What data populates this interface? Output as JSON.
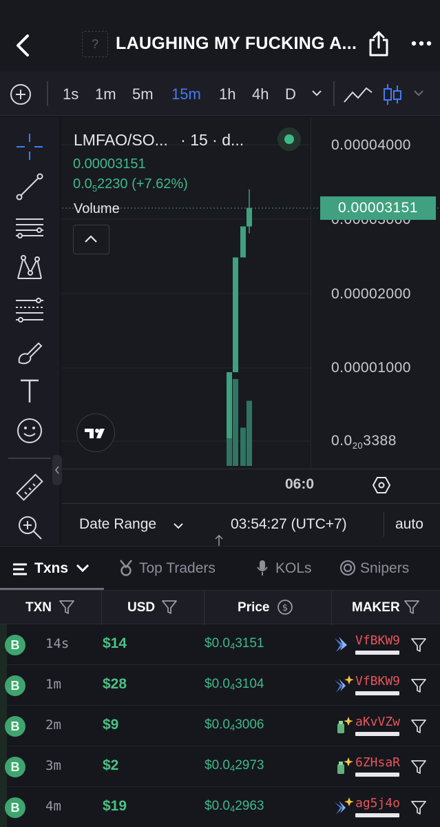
{
  "header": {
    "title": "LAUGHING MY FUCKING A...",
    "token_image_placeholder": "?"
  },
  "toolbar": {
    "timeframes": [
      "1s",
      "1m",
      "5m",
      "15m",
      "1h",
      "4h",
      "D"
    ],
    "active_timeframe": "15m"
  },
  "chart": {
    "symbol": "LMFAO/SO...",
    "interval_label": "· 15 · d...",
    "ohlc_price": "0.00003151",
    "change_prefix": "0.0",
    "change_zero_count": "5",
    "change_digits": "2230",
    "change_pct": "(+7.62%)",
    "volume_label": "Volume",
    "price_tag": "0.00003151",
    "y_ticks": {
      "t1": "0.00004000",
      "t2": "0.00003000",
      "t3": "0.00002000",
      "t4": "0.00001000",
      "t5_prefix": "0.0",
      "t5_zero_count": "20",
      "t5_digits": "3388"
    },
    "x_tick": "06:0",
    "date_range_label": "Date Range",
    "clock": "03:54:27 (UTC+7)",
    "scale_mode": "auto",
    "up_color": "#3fa17f"
  },
  "chart_data": {
    "type": "candlestick",
    "ylim": [
      2e-07,
      4.3e-06
    ],
    "candles": [
      {
        "open": 5.6e-07,
        "close": 9.44e-06,
        "high": 9.44e-06,
        "low": 5.6e-07
      },
      {
        "open": 9.44e-06,
        "close": 2.486e-05,
        "high": 2.486e-05,
        "low": 9.44e-06
      },
      {
        "open": 2.486e-05,
        "close": 2.902e-05,
        "high": 2.902e-05,
        "low": 2.486e-05
      },
      {
        "open": 2.902e-05,
        "close": 3.151e-05,
        "high": 3.401e-05,
        "low": 2.81e-05
      }
    ],
    "volume_relative": [
      1.0,
      1.0,
      0.44,
      0.75
    ]
  },
  "tabs": [
    {
      "label": "Txns",
      "active": true
    },
    {
      "label": "Top Traders",
      "active": false
    },
    {
      "label": "KOLs",
      "active": false
    },
    {
      "label": "Snipers",
      "active": false
    }
  ],
  "table": {
    "headers": [
      "TXN",
      "USD",
      "Price",
      "MAKER"
    ],
    "rows": [
      {
        "type": "B",
        "age": "14s",
        "usd": "$14",
        "price_prefix": "$0.0",
        "price_zeros": "4",
        "price_digits": "3151",
        "maker": "VfBKW9"
      },
      {
        "type": "B",
        "age": "1m",
        "usd": "$28",
        "price_prefix": "$0.0",
        "price_zeros": "4",
        "price_digits": "3104",
        "maker": "VfBKW9"
      },
      {
        "type": "B",
        "age": "2m",
        "usd": "$9",
        "price_prefix": "$0.0",
        "price_zeros": "4",
        "price_digits": "3006",
        "maker": "aKvVZw"
      },
      {
        "type": "B",
        "age": "3m",
        "usd": "$2",
        "price_prefix": "$0.0",
        "price_zeros": "4",
        "price_digits": "2973",
        "maker": "6ZHsaR"
      },
      {
        "type": "B",
        "age": "4m",
        "usd": "$19",
        "price_prefix": "$0.0",
        "price_zeros": "4",
        "price_digits": "2963",
        "maker": "ag5j4o"
      }
    ]
  },
  "icons": {
    "back": "chevron-left-icon",
    "share": "share-icon",
    "more": "more-horizontal-icon",
    "buy_color": "#3fa46f",
    "maker_color": "#e5555b"
  }
}
